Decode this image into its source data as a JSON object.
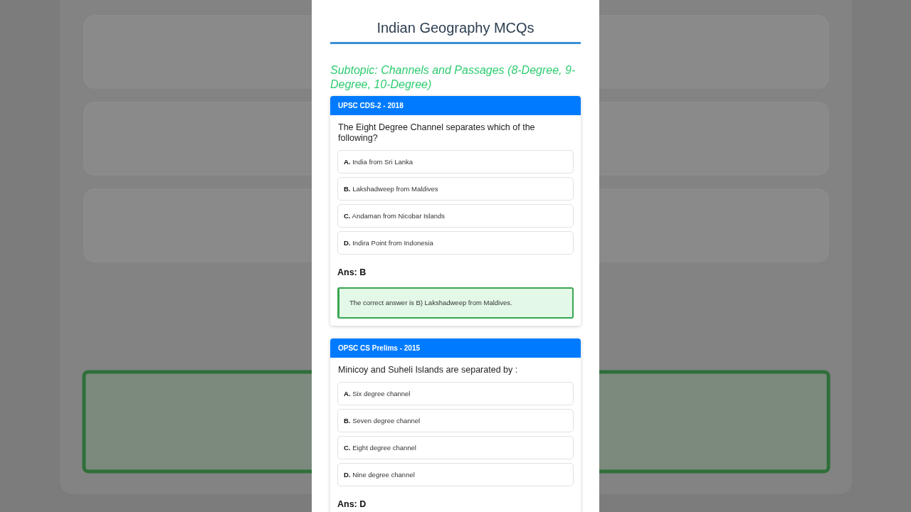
{
  "page": {
    "title": "Indian Geography MCQs",
    "subtopic": "Subtopic: Channels and Passages (8-Degree, 9-Degree, 10-Degree)"
  },
  "questions": [
    {
      "source": "UPSC CDS-2 - 2018",
      "question": "The Eight Degree Channel separates which of the following?",
      "options": [
        {
          "letter": "A.",
          "text": "India from Sri Lanka"
        },
        {
          "letter": "B.",
          "text": "Lakshadweep from Maldives"
        },
        {
          "letter": "C.",
          "text": "Andaman from Nicobar Islands"
        },
        {
          "letter": "D.",
          "text": "Indira Point from Indonesia"
        }
      ],
      "answer": "Ans: B",
      "explanation": "The correct answer is B) Lakshadweep from Maldives."
    },
    {
      "source": "OPSC CS Prelims - 2015",
      "question": "Minicoy and Suheli Islands are separated by :",
      "options": [
        {
          "letter": "A.",
          "text": "Six degree channel"
        },
        {
          "letter": "B.",
          "text": "Seven degree channel"
        },
        {
          "letter": "C.",
          "text": "Eight degree channel"
        },
        {
          "letter": "D.",
          "text": "Nine degree channel"
        }
      ],
      "answer": "Ans: D"
    }
  ]
}
